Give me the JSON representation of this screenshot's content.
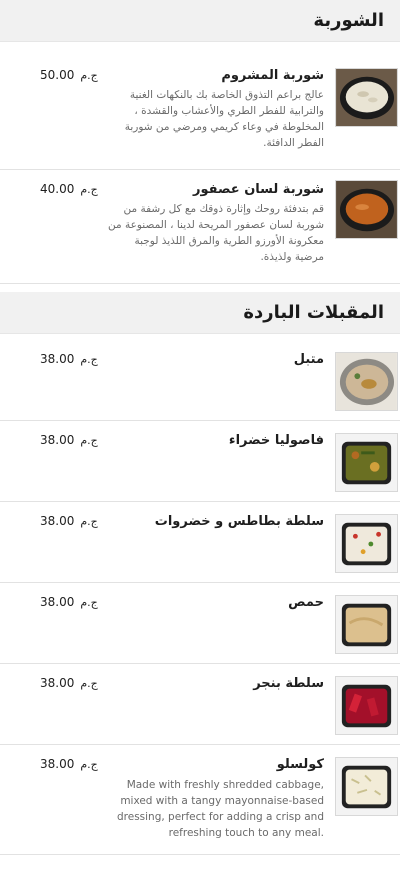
{
  "sections": [
    {
      "title": "الشوربة",
      "items": [
        {
          "name": "شوربة المشروم",
          "price": "50.00",
          "currency": "ج.م",
          "description": "عالج براعم التذوق الخاصة بك بالنكهات الغنية والترابية للفطر الطري والأعشاب والقشدة ، المخلوطة في وعاء كريمي ومرضي من شوربة الفطر الدافئة.",
          "image_icon": "mushroom-soup-bowl-icon"
        },
        {
          "name": "شوربة لسان عصفور",
          "price": "40.00",
          "currency": "ج.م",
          "description": "قم بتدفئة روحك وإثارة ذوقك مع كل رشفة من شوربة لسان عصفور المريحة لدينا ، المصنوعة من معكرونة الأورزو الطرية والمرق اللذيذ لوجبة مرضية ولذيذة.",
          "image_icon": "orzo-soup-bowl-icon"
        }
      ]
    },
    {
      "title": "المقبلات الباردة",
      "items": [
        {
          "name": "متبل",
          "price": "38.00",
          "currency": "ج.م",
          "description": "",
          "image_icon": "moutabal-plate-icon"
        },
        {
          "name": "فاصوليا خضراء",
          "price": "38.00",
          "currency": "ج.م",
          "description": "",
          "image_icon": "green-beans-tray-icon"
        },
        {
          "name": "سلطة بطاطس و خضروات",
          "price": "38.00",
          "currency": "ج.م",
          "description": "",
          "image_icon": "potato-salad-tray-icon"
        },
        {
          "name": "حمص",
          "price": "38.00",
          "currency": "ج.م",
          "description": "",
          "image_icon": "hummus-tray-icon"
        },
        {
          "name": "سلطة بنجر",
          "price": "38.00",
          "currency": "ج.م",
          "description": "",
          "image_icon": "beet-salad-tray-icon"
        },
        {
          "name": "كولسلو",
          "price": "38.00",
          "currency": "ج.م",
          "description": "Made with freshly shredded cabbage, mixed with a tangy mayonnaise-based dressing, perfect for adding a crisp and refreshing touch to any meal.",
          "image_icon": "coleslaw-tray-icon"
        }
      ]
    }
  ]
}
